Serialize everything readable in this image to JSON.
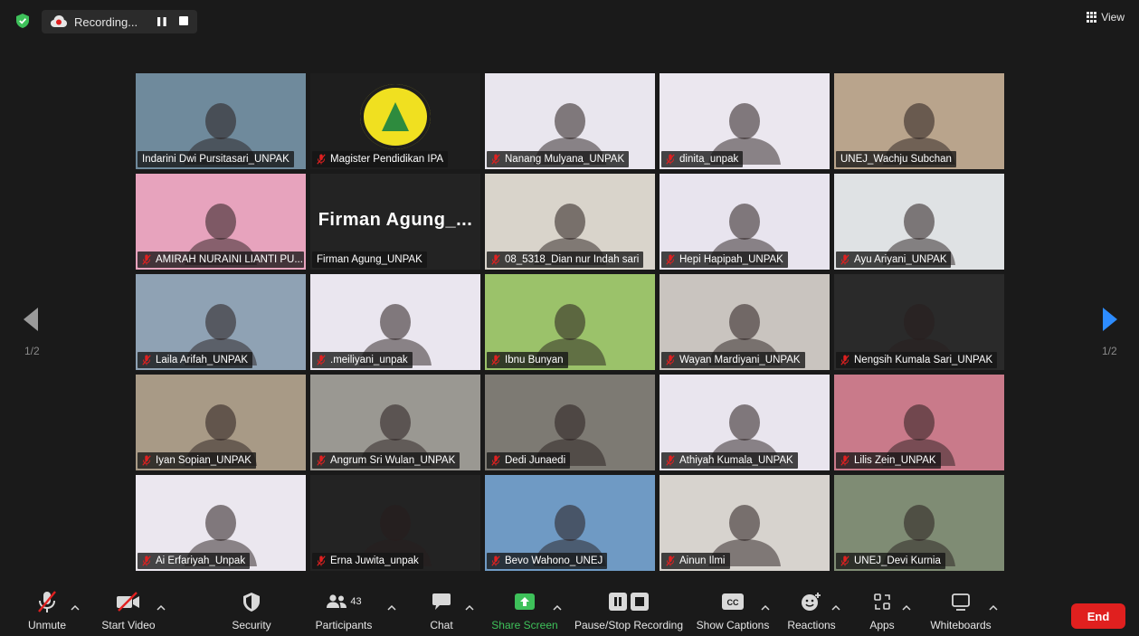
{
  "recording": {
    "label": "Recording..."
  },
  "view": {
    "label": "View"
  },
  "pages": {
    "left": "1/2",
    "right": "1/2"
  },
  "participants": [
    {
      "name": "Indarini Dwi Pursitasari_UNPAK",
      "muted": false,
      "active": true,
      "bg": "#6f8a9c"
    },
    {
      "name": "Magister Pendidikan IPA",
      "muted": true,
      "active": false,
      "bg": "#1e1e1e"
    },
    {
      "name": "Nanang Mulyana_UNPAK",
      "muted": true,
      "active": false,
      "bg": "#e9e6ee"
    },
    {
      "name": "dinita_unpak",
      "muted": true,
      "active": false,
      "bg": "#ebe7ef"
    },
    {
      "name": "UNEJ_Wachju Subchan",
      "muted": false,
      "active": false,
      "bg": "#b9a48c"
    },
    {
      "name": "AMIRAH NURAINI LIANTI PU...",
      "muted": true,
      "active": false,
      "bg": "#e7a3bd"
    },
    {
      "name": "Firman Agung_UNPAK",
      "muted": false,
      "active": false,
      "bg": "#232323",
      "big_name": "Firman  Agung_..."
    },
    {
      "name": "08_5318_Dian nur Indah sari",
      "muted": true,
      "active": false,
      "bg": "#d9d4cb"
    },
    {
      "name": "Hepi Hapipah_UNPAK",
      "muted": true,
      "active": false,
      "bg": "#e8e4ee"
    },
    {
      "name": "Ayu Ariyani_UNPAK",
      "muted": true,
      "active": false,
      "bg": "#dfe2e4"
    },
    {
      "name": "Laila Arifah_UNPAK",
      "muted": true,
      "active": false,
      "bg": "#8fa2b4"
    },
    {
      "name": ".meiliyani_unpak",
      "muted": true,
      "active": false,
      "bg": "#eae6ef"
    },
    {
      "name": "Ibnu Bunyan",
      "muted": true,
      "active": false,
      "bg": "#9bc26a"
    },
    {
      "name": "Wayan Mardiyani_UNPAK",
      "muted": true,
      "active": false,
      "bg": "#c9c4bf"
    },
    {
      "name": "Nengsih Kumala Sari_UNPAK",
      "muted": true,
      "active": false,
      "bg": "#2a2a2a"
    },
    {
      "name": "Iyan Sopian_UNPAK",
      "muted": true,
      "active": false,
      "bg": "#a89a86"
    },
    {
      "name": "Angrum Sri Wulan_UNPAK",
      "muted": true,
      "active": false,
      "bg": "#9a9892"
    },
    {
      "name": "Dedi Junaedi",
      "muted": true,
      "active": false,
      "bg": "#7d7a73"
    },
    {
      "name": "Athiyah Kumala_UNPAK",
      "muted": true,
      "active": false,
      "bg": "#e9e5ee"
    },
    {
      "name": "Lilis Zein_UNPAK",
      "muted": true,
      "active": false,
      "bg": "#c97a8a"
    },
    {
      "name": "Ai Erfariyah_Unpak",
      "muted": true,
      "active": false,
      "bg": "#ebe7ef"
    },
    {
      "name": "Erna Juwita_unpak",
      "muted": true,
      "active": false,
      "bg": "#232323"
    },
    {
      "name": "Bevo Wahono_UNEJ",
      "muted": true,
      "active": false,
      "bg": "#6f9ac4"
    },
    {
      "name": "Ainun Ilmi",
      "muted": true,
      "active": false,
      "bg": "#d7d3ce"
    },
    {
      "name": "UNEJ_Devi Kurnia",
      "muted": true,
      "active": false,
      "bg": "#7f8c74"
    }
  ],
  "toolbar": {
    "unmute": "Unmute",
    "start_video": "Start Video",
    "security": "Security",
    "participants": "Participants",
    "participants_count": "43",
    "chat": "Chat",
    "share_screen": "Share Screen",
    "pause_stop_recording": "Pause/Stop Recording",
    "show_captions": "Show Captions",
    "captions_badge": "CC",
    "reactions": "Reactions",
    "apps": "Apps",
    "whiteboards": "Whiteboards",
    "end": "End"
  },
  "colors": {
    "accent_green": "#3ec15a",
    "end_red": "#e0201f",
    "active_border": "#c8d96a"
  }
}
